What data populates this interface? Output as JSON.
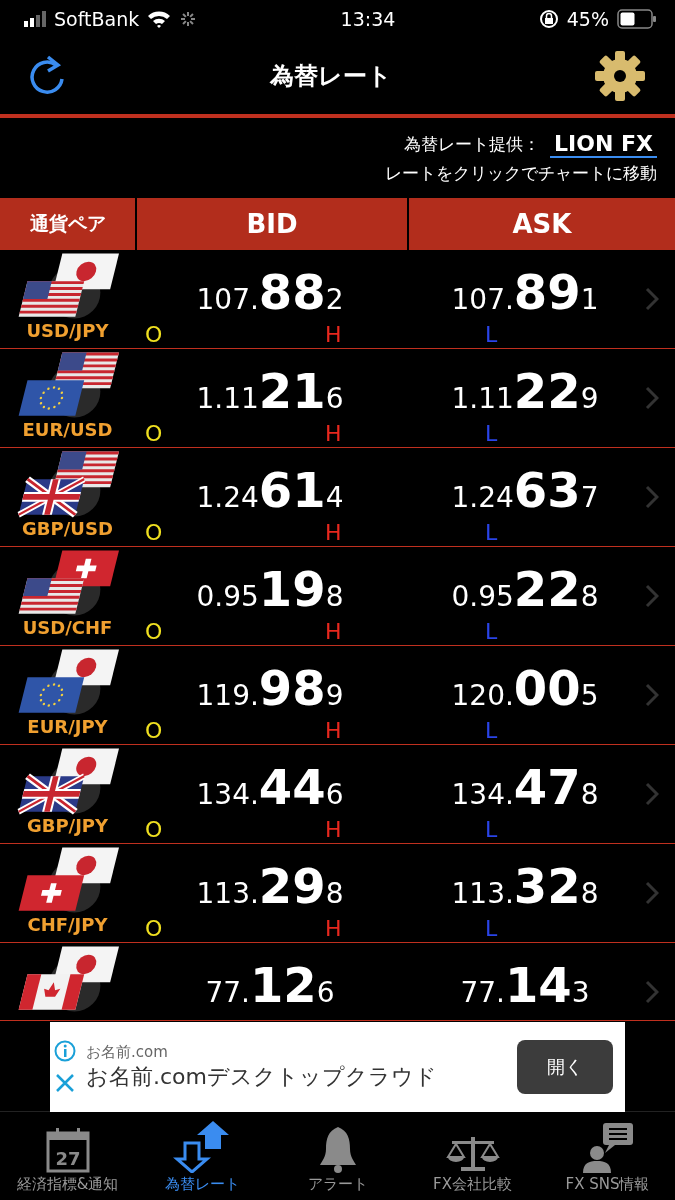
{
  "status_bar": {
    "carrier": "SoftBank",
    "time": "13:34",
    "battery": "45%"
  },
  "header": {
    "title": "為替レート"
  },
  "info": {
    "provider_label": "為替レート提供：",
    "provider": "LION FX",
    "hint": "レートをクリックでチャートに移動"
  },
  "table": {
    "columns": [
      "通貨ペア",
      "BID",
      "ASK"
    ],
    "rows": [
      {
        "pair": "USD/JPY",
        "flags": [
          {
            "kind": "us"
          },
          {
            "kind": "jp"
          }
        ],
        "bid": {
          "pre": "107.",
          "main": "88",
          "post": "2"
        },
        "ask": {
          "pre": "107.",
          "main": "89",
          "post": "1"
        },
        "open": "O",
        "high": "H",
        "low": "L"
      },
      {
        "pair": "EUR/USD",
        "flags": [
          {
            "kind": "eu"
          },
          {
            "kind": "us"
          }
        ],
        "bid": {
          "pre": "1.11",
          "main": "21",
          "post": "6"
        },
        "ask": {
          "pre": "1.11",
          "main": "22",
          "post": "9"
        },
        "open": "O",
        "high": "H",
        "low": "L"
      },
      {
        "pair": "GBP/USD",
        "flags": [
          {
            "kind": "gb"
          },
          {
            "kind": "us"
          }
        ],
        "bid": {
          "pre": "1.24",
          "main": "61",
          "post": "4"
        },
        "ask": {
          "pre": "1.24",
          "main": "63",
          "post": "7"
        },
        "open": "O",
        "high": "H",
        "low": "L"
      },
      {
        "pair": "USD/CHF",
        "flags": [
          {
            "kind": "us"
          },
          {
            "kind": "ch"
          }
        ],
        "bid": {
          "pre": "0.95",
          "main": "19",
          "post": "8"
        },
        "ask": {
          "pre": "0.95",
          "main": "22",
          "post": "8"
        },
        "open": "O",
        "high": "H",
        "low": "L"
      },
      {
        "pair": "EUR/JPY",
        "flags": [
          {
            "kind": "eu"
          },
          {
            "kind": "jp"
          }
        ],
        "bid": {
          "pre": "119.",
          "main": "98",
          "post": "9"
        },
        "ask": {
          "pre": "120.",
          "main": "00",
          "post": "5"
        },
        "open": "O",
        "high": "H",
        "low": "L"
      },
      {
        "pair": "GBP/JPY",
        "flags": [
          {
            "kind": "gb"
          },
          {
            "kind": "jp"
          }
        ],
        "bid": {
          "pre": "134.",
          "main": "44",
          "post": "6"
        },
        "ask": {
          "pre": "134.",
          "main": "47",
          "post": "8"
        },
        "open": "O",
        "high": "H",
        "low": "L"
      },
      {
        "pair": "CHF/JPY",
        "flags": [
          {
            "kind": "ch"
          },
          {
            "kind": "jp"
          }
        ],
        "bid": {
          "pre": "113.",
          "main": "29",
          "post": "8"
        },
        "ask": {
          "pre": "113.",
          "main": "32",
          "post": "8"
        },
        "open": "O",
        "high": "H",
        "low": "L"
      },
      {
        "flags": [
          {
            "kind": "ca"
          },
          {
            "kind": "jp"
          }
        ],
        "bid": {
          "pre": "77.",
          "main": "12",
          "post": "6"
        },
        "ask": {
          "pre": "77.",
          "main": "14",
          "post": "3"
        }
      }
    ]
  },
  "ad": {
    "advertiser": "お名前.com",
    "headline": "お名前.comデスクトップクラウド",
    "button": "開く"
  },
  "tabs": [
    {
      "kind": "calendar",
      "label": "経済指標&通知",
      "icon_text": "27",
      "selected": false
    },
    {
      "kind": "arrows",
      "label": "為替レート",
      "selected": true
    },
    {
      "kind": "bell",
      "label": "アラート",
      "selected": false
    },
    {
      "kind": "scale",
      "label": "FX会社比較",
      "selected": false
    },
    {
      "kind": "chat",
      "label": "FX SNS情報",
      "selected": false
    }
  ]
}
